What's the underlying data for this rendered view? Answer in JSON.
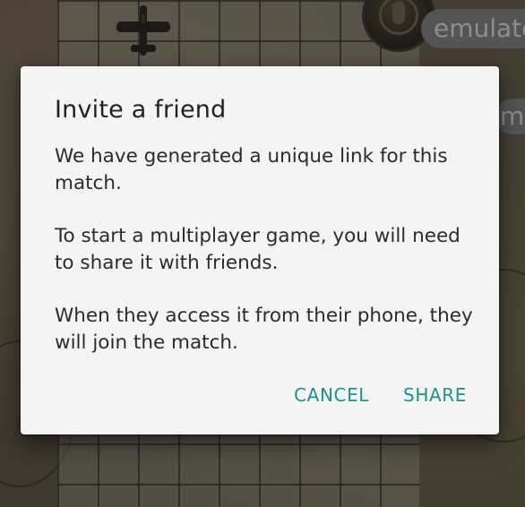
{
  "background": {
    "emulator_label": "emulato",
    "side_chip_label": "m"
  },
  "dialog": {
    "title": "Invite a friend",
    "paragraphs": [
      "We have generated a unique link for this match.",
      "To start a multiplayer game, you will need to share it with friends.",
      "When they access it from their phone, they will join the match."
    ],
    "cancel_label": "CANCEL",
    "share_label": "SHARE"
  },
  "colors": {
    "accent": "#179688",
    "dialog_bg": "#f4f4f4",
    "title_text": "#212121",
    "body_text": "#2b2b2b"
  },
  "icons": {
    "plane": "plane-icon",
    "voice": "microphone-icon"
  }
}
